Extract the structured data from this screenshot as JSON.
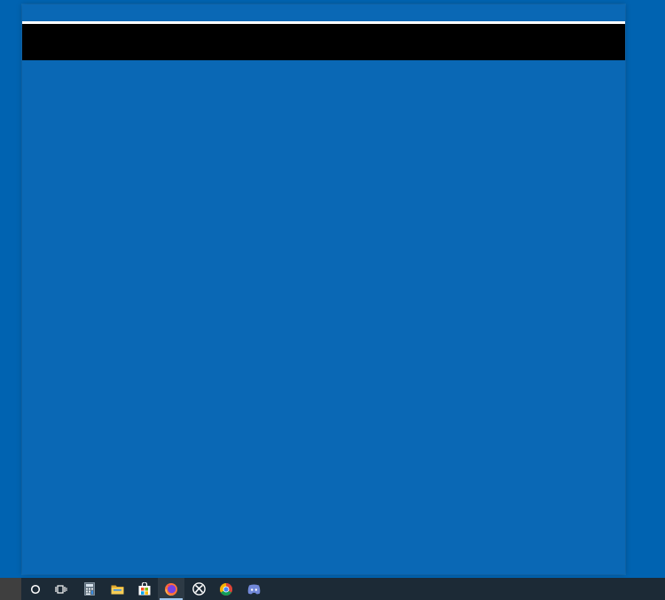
{
  "desktop": {
    "background": "#0063b1"
  },
  "start_menu": {
    "background": "#0a68b5",
    "header_bar": "#000000"
  },
  "taskbar": {
    "background": "#1c2a36",
    "items": [
      {
        "icon": "cortana-icon",
        "active": false
      },
      {
        "icon": "task-view-icon",
        "active": false
      },
      {
        "icon": "calculator-icon",
        "active": false
      },
      {
        "icon": "file-explorer-icon",
        "active": false
      },
      {
        "icon": "microsoft-store-icon",
        "active": false
      },
      {
        "icon": "firefox-icon",
        "active": true
      },
      {
        "icon": "xbox-icon",
        "active": false
      },
      {
        "icon": "chrome-icon",
        "active": false
      },
      {
        "icon": "discord-icon",
        "active": false
      }
    ]
  }
}
